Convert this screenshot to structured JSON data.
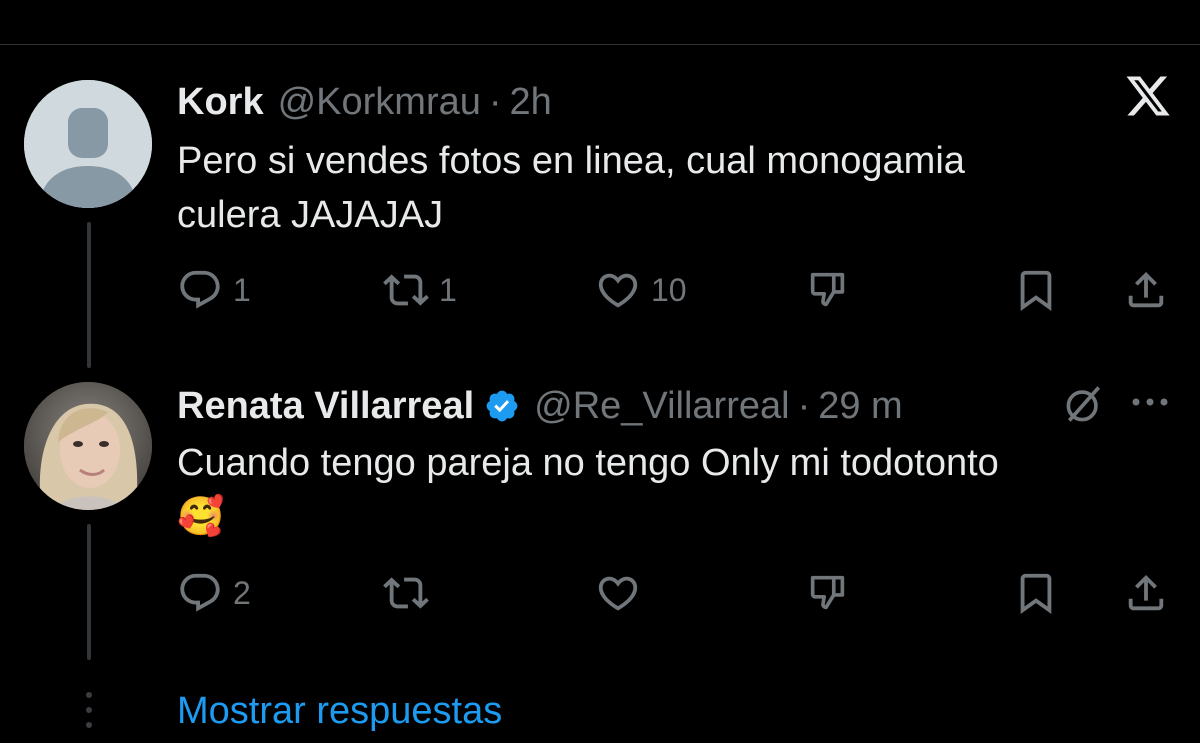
{
  "tweets": [
    {
      "name": "Kork",
      "handle": "@Korkmrau",
      "separator": "·",
      "time": "2h",
      "text_line1": "Pero si vendes fotos en linea, cual monogamia",
      "text_line2": "culera JAJAJAJ",
      "avatar": "default-avatar-icon",
      "replies": "1",
      "retweets": "1",
      "likes": "10"
    },
    {
      "name": "Renata Villarreal",
      "handle": "@Re_Villarreal",
      "separator": "·",
      "time": "29 m",
      "verified": true,
      "text_line1": "Cuando tengo pareja no tengo Only mi todotonto",
      "text_line2": "🥰",
      "avatar": "profile-photo",
      "replies": "2",
      "retweets": "",
      "likes": ""
    }
  ],
  "show_replies_label": "Mostrar respuestas",
  "colors": {
    "background": "#000000",
    "text": "#e7e9ea",
    "muted": "#71767b",
    "accent": "#1d9bf0"
  }
}
